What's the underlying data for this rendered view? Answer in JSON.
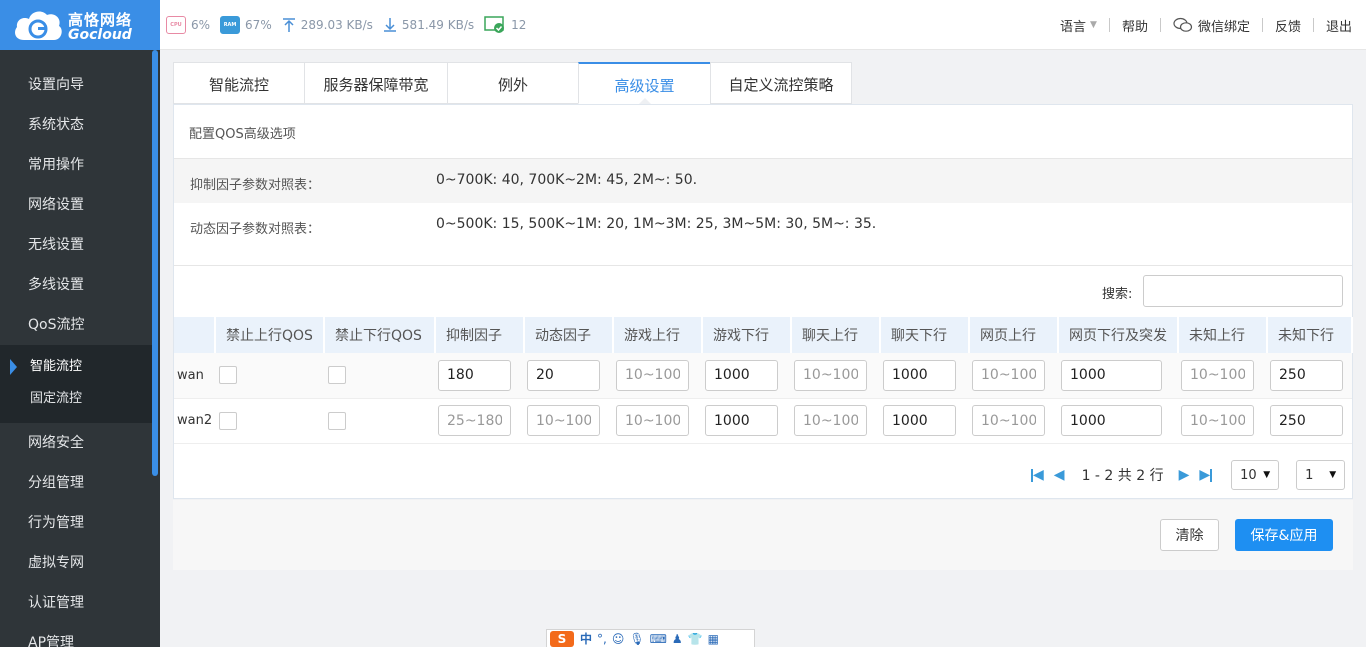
{
  "brand": {
    "name_cn": "高恪网络",
    "name_en": "Gocloud"
  },
  "stats": {
    "cpu_label": "CPU",
    "cpu": "6%",
    "ram_label": "RAM",
    "ram": "67%",
    "upload": "289.03 KB/s",
    "download": "581.49 KB/s",
    "devices": "12"
  },
  "nav": {
    "language": "语言",
    "help": "帮助",
    "wechat": "微信绑定",
    "feedback": "反馈",
    "logout": "退出"
  },
  "sidebar": {
    "items": [
      "设置向导",
      "系统状态",
      "常用操作",
      "网络设置",
      "无线设置",
      "多线设置",
      "QoS流控"
    ],
    "sub_items": [
      "智能流控",
      "固定流控"
    ],
    "items_after": [
      "网络安全",
      "分组管理",
      "行为管理",
      "虚拟专网",
      "认证管理",
      "AP管理"
    ]
  },
  "tabs": [
    "智能流控",
    "服务器保障带宽",
    "例外",
    "高级设置",
    "自定义流控策略"
  ],
  "panel": {
    "title": "配置QOS高级选项",
    "ref": [
      {
        "label": "抑制因子参数对照表：",
        "value": "0~700K: 40, 700K~2M: 45, 2M~: 50."
      },
      {
        "label": "动态因子参数对照表：",
        "value": "0~500K: 15, 500K~1M: 20, 1M~3M: 25, 3M~5M: 30, 5M~: 35."
      }
    ],
    "search_label": "搜索:"
  },
  "table": {
    "headers": [
      "",
      "禁止上行QOS",
      "禁止下行QOS",
      "抑制因子",
      "动态因子",
      "游戏上行",
      "游戏下行",
      "聊天上行",
      "聊天下行",
      "网页上行",
      "网页下行及突发",
      "未知上行",
      "未知下行"
    ],
    "rows": [
      {
        "iface": "wan",
        "inh": {
          "value": "180",
          "placeholder": ""
        },
        "dyn": {
          "value": "20",
          "placeholder": ""
        },
        "game_up": {
          "value": "",
          "placeholder": "10~1000"
        },
        "game_down": {
          "value": "1000",
          "placeholder": ""
        },
        "chat_up": {
          "value": "",
          "placeholder": "10~1000"
        },
        "chat_down": {
          "value": "1000",
          "placeholder": ""
        },
        "web_up": {
          "value": "",
          "placeholder": "10~1000"
        },
        "web_down": {
          "value": "1000",
          "placeholder": ""
        },
        "unk_up": {
          "value": "",
          "placeholder": "10~1000"
        },
        "unk_down": {
          "value": "250",
          "placeholder": ""
        }
      },
      {
        "iface": "wan2",
        "inh": {
          "value": "",
          "placeholder": "25~180"
        },
        "dyn": {
          "value": "",
          "placeholder": "10~100"
        },
        "game_up": {
          "value": "",
          "placeholder": "10~1000"
        },
        "game_down": {
          "value": "1000",
          "placeholder": ""
        },
        "chat_up": {
          "value": "",
          "placeholder": "10~1000"
        },
        "chat_down": {
          "value": "1000",
          "placeholder": ""
        },
        "web_up": {
          "value": "",
          "placeholder": "10~1000"
        },
        "web_down": {
          "value": "1000",
          "placeholder": ""
        },
        "unk_up": {
          "value": "",
          "placeholder": "10~1000"
        },
        "unk_down": {
          "value": "250",
          "placeholder": ""
        }
      }
    ]
  },
  "pager": {
    "info": "1 - 2 共 2 行",
    "page_size": "10",
    "page": "1"
  },
  "actions": {
    "clear": "清除",
    "save": "保存&应用"
  },
  "ime": {
    "logo": "S",
    "mode": "中",
    "punct": "°,"
  },
  "colors": {
    "accent": "#3a8ee6",
    "sidebar_bg": "#2f3539",
    "header_bg": "#eaf2fb",
    "save_btn": "#1e8ff2"
  }
}
